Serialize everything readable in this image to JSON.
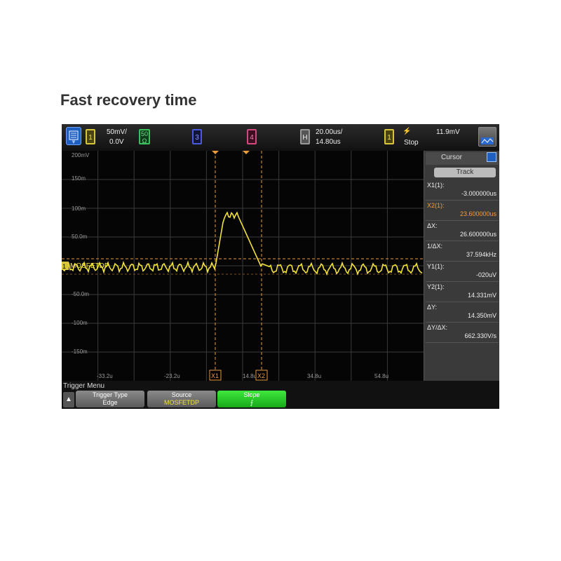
{
  "page_title": "Fast recovery time",
  "topbar": {
    "ch1_scale": "50mV/",
    "ch1_offset": "0.0V",
    "ch1_num": "1",
    "ch2_label_a": "50",
    "ch2_label_b": "Ω",
    "ch3_num": "3",
    "ch4_num": "4",
    "horiz_label": "H",
    "horiz_scale": "20.00us/",
    "horiz_pos": "14.80us",
    "trig_ch": "1",
    "trig_icon": "⚡",
    "trig_mode": "Stop",
    "trig_level": "11.9mV"
  },
  "grid": {
    "y_labels": [
      "200mV",
      "150m",
      "100m",
      "50.0m",
      "-50.0m",
      "-100m",
      "-150m"
    ],
    "x_labels": [
      "-33.2u",
      "-23.2u",
      "14.8u",
      "34.8u",
      "54.8u"
    ],
    "channel_label": "MOSFETDP",
    "cursor_x1_label": "X1",
    "cursor_x2_label": "X2",
    "colors": {
      "trace": "#f2e23a",
      "cursor": "#e89a3c",
      "grid": "#3a3a3a"
    }
  },
  "cursor_panel": {
    "title": "Cursor",
    "track_label": "Track",
    "rows": [
      {
        "label": "X1(1):",
        "value": "-3.000000us",
        "accent": false
      },
      {
        "label": "X2(1):",
        "value": "23.600000us",
        "accent": true
      },
      {
        "label": "ΔX:",
        "value": "26.600000us",
        "accent": false
      },
      {
        "label": "1/ΔX:",
        "value": "37.594kHz",
        "accent": false
      },
      {
        "label": "Y1(1):",
        "value": "-020uV",
        "accent": false
      },
      {
        "label": "Y2(1):",
        "value": "14.331mV",
        "accent": false
      },
      {
        "label": "ΔY:",
        "value": "14.350mV",
        "accent": false
      },
      {
        "label": "ΔY/ΔX:",
        "value": "662.330V/s",
        "accent": false
      }
    ]
  },
  "bottom_menu": {
    "title": "Trigger Menu",
    "buttons": [
      {
        "top": "Trigger Type",
        "bottom": "Edge"
      },
      {
        "top": "Source",
        "bottom": "MOSFETDP"
      },
      {
        "top": "Slope",
        "bottom": "⨍"
      }
    ]
  }
}
